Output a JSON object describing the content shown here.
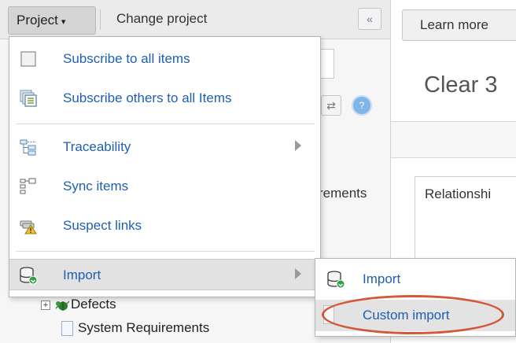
{
  "topbar": {
    "project_label": "Project",
    "caret": "▾",
    "change_project_label": "Change project",
    "collapse_icon": "«"
  },
  "background": {
    "requirements_fragment": "rements",
    "tree_items": [
      {
        "label": "Defects",
        "icon": "bug-icon",
        "expander": "+"
      },
      {
        "label": "System Requirements",
        "icon": "document-icon"
      }
    ],
    "refresh_icon": "⇄",
    "help_icon": "?"
  },
  "right_panel": {
    "learn_more_label": "Learn more",
    "clear_title": "Clear 3",
    "relationships_fragment": "Relationshi"
  },
  "project_menu": {
    "items": [
      {
        "label": "Subscribe to all items",
        "icon": "subscribe-icon",
        "has_submenu": false
      },
      {
        "label": "Subscribe others to all Items",
        "icon": "subscribe-others-icon",
        "has_submenu": false
      },
      {
        "label": "Traceability",
        "icon": "traceability-icon",
        "has_submenu": true
      },
      {
        "label": "Sync items",
        "icon": "sync-items-icon",
        "has_submenu": false
      },
      {
        "label": "Suspect links",
        "icon": "suspect-links-icon",
        "has_submenu": false
      },
      {
        "label": "Import",
        "icon": "import-icon",
        "has_submenu": true,
        "active": true
      }
    ]
  },
  "import_submenu": {
    "items": [
      {
        "label": "Import",
        "icon": "import-icon"
      },
      {
        "label": "Custom import",
        "highlighted": true
      }
    ]
  },
  "colors": {
    "menu_link": "#1f5fb0",
    "annotation_oval": "#d2583a",
    "active_row": "#e2e2e2"
  }
}
